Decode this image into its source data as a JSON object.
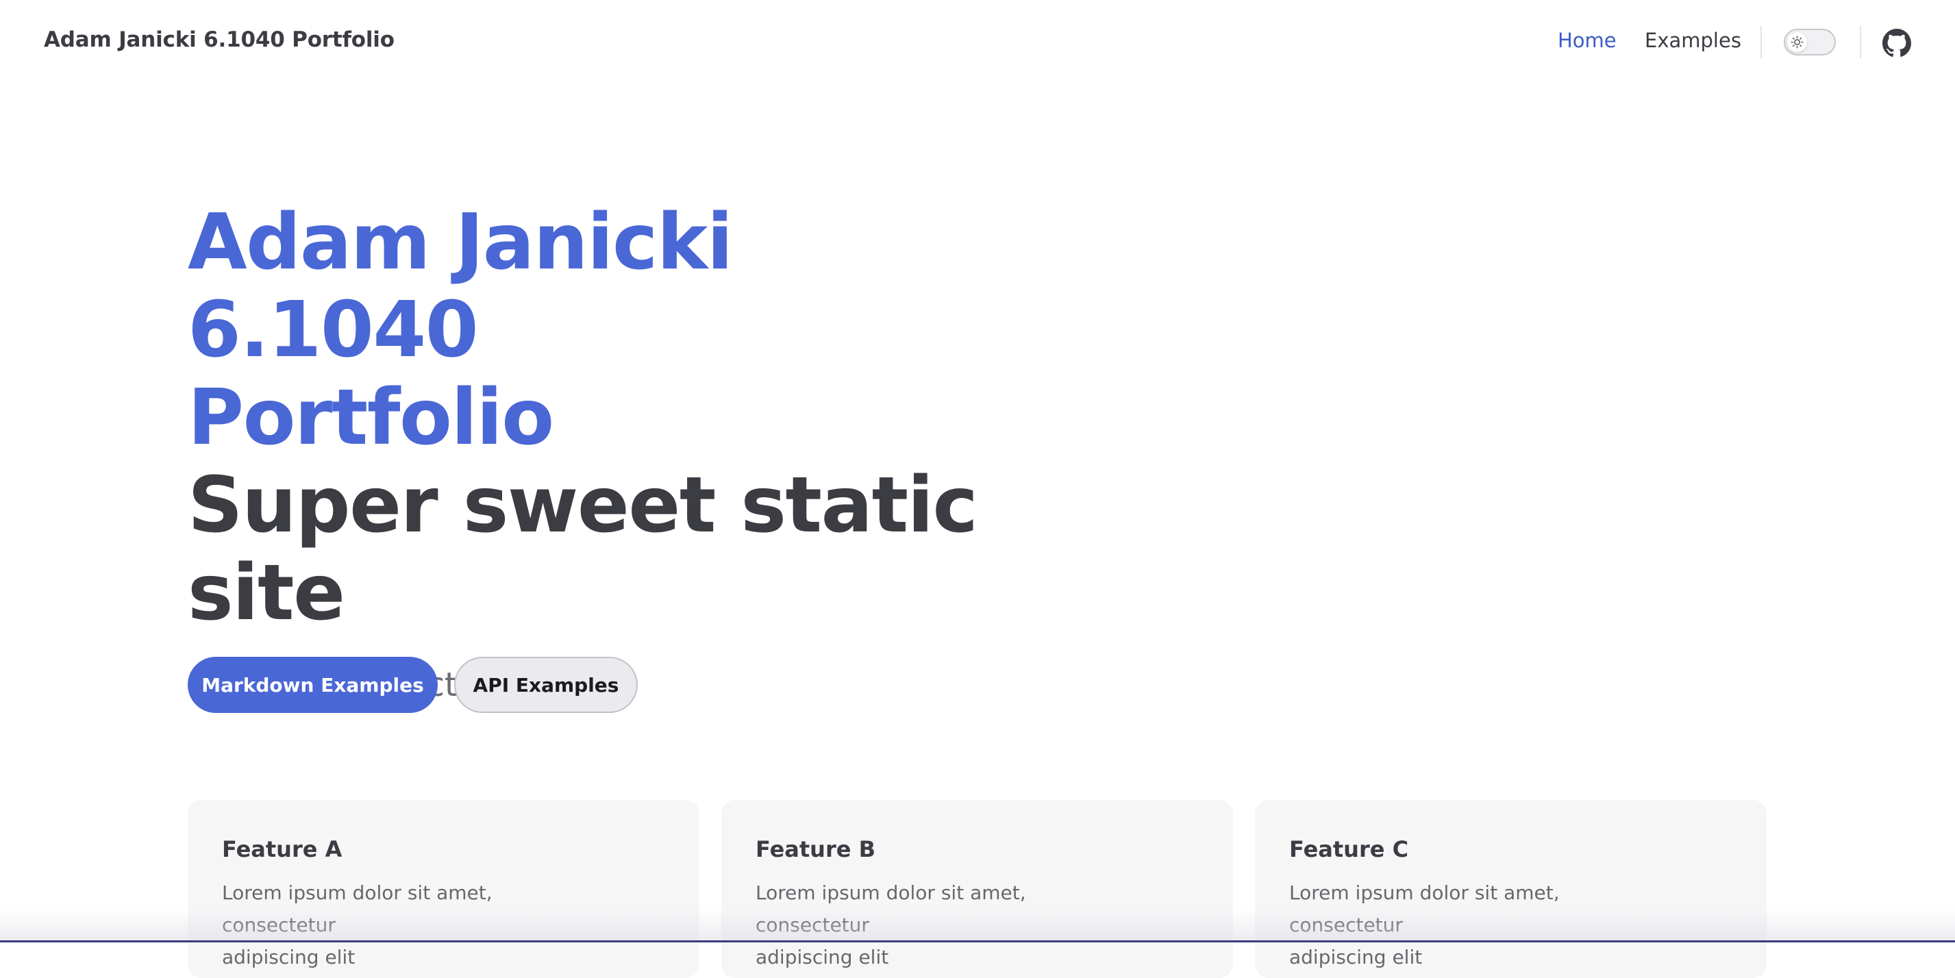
{
  "nav": {
    "title": "Adam Janicki 6.1040 Portfolio",
    "links": [
      {
        "label": "Home",
        "active": true
      },
      {
        "label": "Examples",
        "active": false
      }
    ],
    "theme_toggle_icon": "sun-icon",
    "social_icon": "github-icon"
  },
  "hero": {
    "name_line1": "Adam Janicki 6.1040",
    "name_line2": "Portfolio",
    "text_line1": "Super sweet static",
    "text_line2": "site",
    "tagline": "My great project tagline",
    "actions": [
      {
        "label": "Markdown Examples",
        "theme": "brand"
      },
      {
        "label": "API Examples",
        "theme": "alt"
      }
    ]
  },
  "features": [
    {
      "title": "Feature A",
      "details_line1": "Lorem ipsum dolor sit amet, consectetur",
      "details_line2": "adipiscing elit"
    },
    {
      "title": "Feature B",
      "details_line1": "Lorem ipsum dolor sit amet, consectetur",
      "details_line2": "adipiscing elit"
    },
    {
      "title": "Feature C",
      "details_line1": "Lorem ipsum dolor sit amet, consectetur",
      "details_line2": "adipiscing elit"
    }
  ],
  "colors": {
    "brand": "#4a67d6",
    "text": "#3c3c43",
    "muted": "#6b6b72",
    "feature_bg": "#f6f6f7"
  }
}
